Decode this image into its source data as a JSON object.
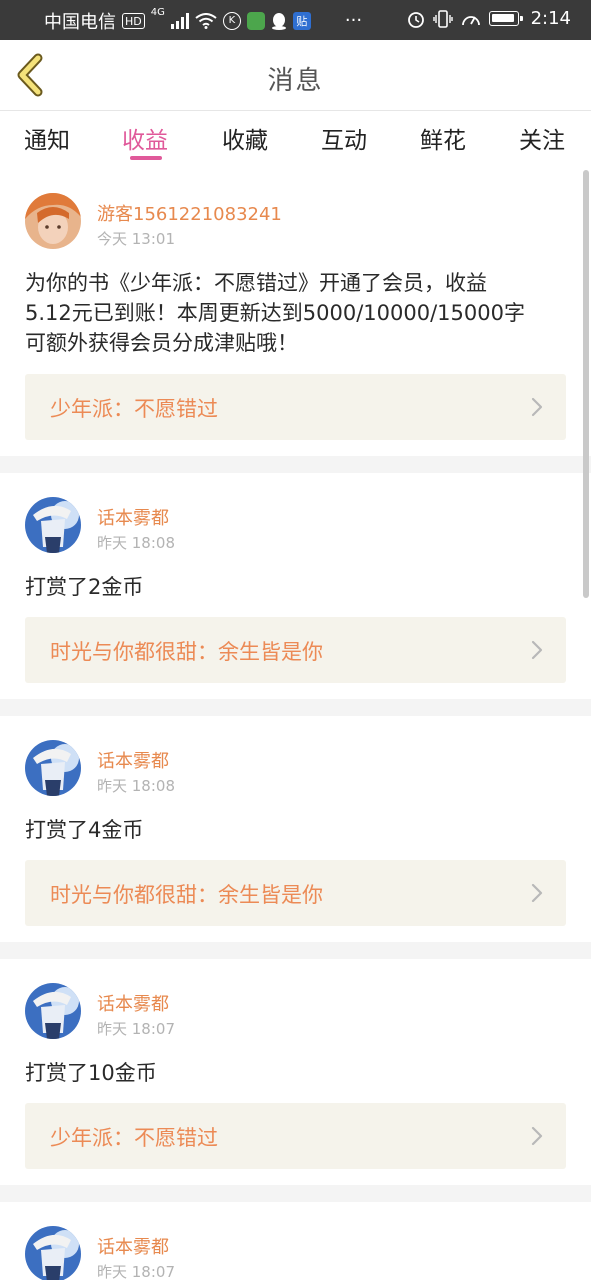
{
  "status_bar": {
    "carrier": "中国电信",
    "hd_badge": "HD",
    "network": "4G",
    "time": "2:14",
    "icons": [
      "hd-icon",
      "signal-icon",
      "wifi-icon",
      "k-app-icon",
      "video-app-icon",
      "qq-icon",
      "news-app-icon",
      "more-icon",
      "alarm-icon",
      "vibrate-icon",
      "speed-icon",
      "battery-icon"
    ]
  },
  "header": {
    "title": "消息",
    "back_icon": "chevron-left-icon"
  },
  "tabs": [
    {
      "label": "通知",
      "active": false
    },
    {
      "label": "收益",
      "active": true
    },
    {
      "label": "收藏",
      "active": false
    },
    {
      "label": "互动",
      "active": false
    },
    {
      "label": "鲜花",
      "active": false
    },
    {
      "label": "关注",
      "active": false
    }
  ],
  "colors": {
    "accent": "#e0599a",
    "username": "#e7894e",
    "book_link_text": "#ec8a55",
    "book_link_bg": "#f5f3eb"
  },
  "messages": [
    {
      "user": "游客1561221083241",
      "time": "今天 13:01",
      "text_lines": [
        "为你的书《少年派：不愿错过》开通了会员，收益",
        "5.12元已到账！本周更新达到5000/10000/15000字",
        "可额外获得会员分成津贴哦！"
      ],
      "book": "少年派：不愿错过"
    },
    {
      "user": "话本雾都",
      "time": "昨天 18:08",
      "text_lines": [
        "打赏了2金币"
      ],
      "book": "时光与你都很甜：余生皆是你"
    },
    {
      "user": "话本雾都",
      "time": "昨天 18:08",
      "text_lines": [
        "打赏了4金币"
      ],
      "book": "时光与你都很甜：余生皆是你"
    },
    {
      "user": "话本雾都",
      "time": "昨天 18:07",
      "text_lines": [
        "打赏了10金币"
      ],
      "book": "少年派：不愿错过"
    },
    {
      "user": "话本雾都",
      "time": "昨天 18:07",
      "text_lines": [],
      "book": ""
    }
  ]
}
